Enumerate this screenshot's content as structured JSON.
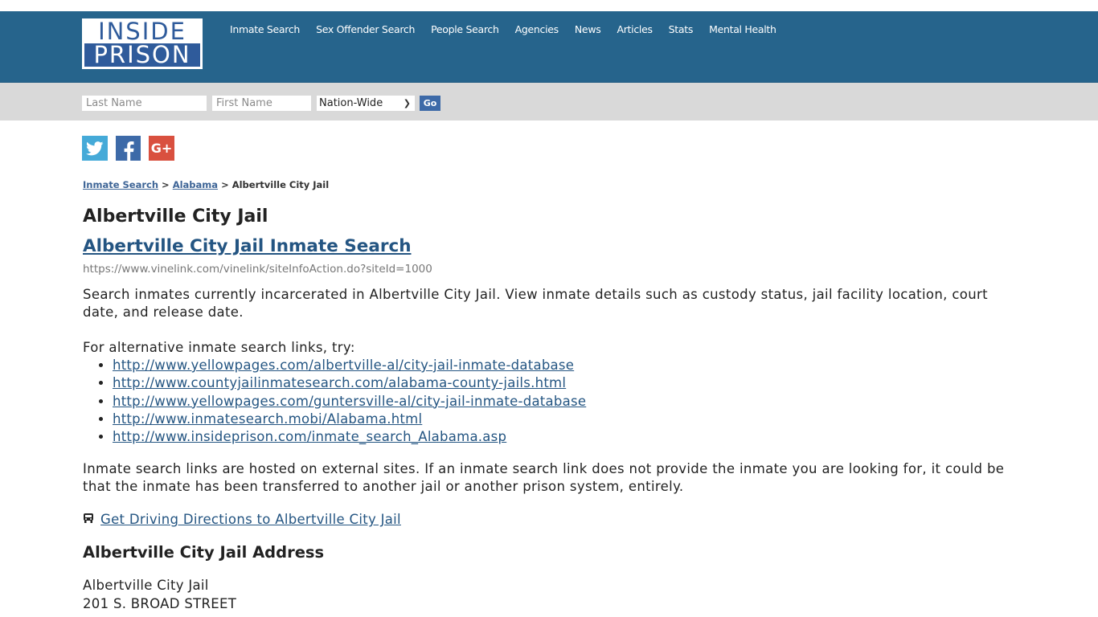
{
  "logo": {
    "line1": "INSIDE",
    "line2": "PRISON"
  },
  "nav": [
    {
      "label": "Inmate Search"
    },
    {
      "label": "Sex Offender Search"
    },
    {
      "label": "People Search"
    },
    {
      "label": "Agencies"
    },
    {
      "label": "News"
    },
    {
      "label": "Articles"
    },
    {
      "label": "Stats"
    },
    {
      "label": "Mental Health"
    }
  ],
  "search": {
    "last_name_placeholder": "Last Name",
    "first_name_placeholder": "First Name",
    "scope_selected": "Nation-Wide",
    "go_label": "Go"
  },
  "social": {
    "twitter": "twitter-icon",
    "facebook": "facebook-icon",
    "google_plus": "google-plus-icon",
    "gplus_text": "G+"
  },
  "breadcrumb": {
    "items": [
      "Inmate Search",
      "Alabama"
    ],
    "separator": ">",
    "current": "Albertville City Jail"
  },
  "page": {
    "title": "Albertville City Jail",
    "primary_link": "Albertville City Jail Inmate Search",
    "primary_url": "https://www.vinelink.com/vinelink/siteInfoAction.do?siteId=1000",
    "description": "Search inmates currently incarcerated in Albertville City Jail. View inmate details such as custody status, jail facility location, court date, and release date.",
    "alt_intro": "For alternative inmate search links, try:",
    "alt_links": [
      "http://www.yellowpages.com/albertville-al/city-jail-inmate-database",
      "http://www.countyjailinmatesearch.com/alabama-county-jails.html",
      "http://www.yellowpages.com/guntersville-al/city-jail-inmate-database",
      "http://www.inmatesearch.mobi/Alabama.html",
      "http://www.insideprison.com/inmate_search_Alabama.asp"
    ],
    "note": "Inmate search links are hosted on external sites. If an inmate search link does not provide the inmate you are looking for, it could be that the inmate has been transferred to another jail or another prison system, entirely.",
    "directions_icon": "bus-icon",
    "directions_link": "Get Driving Directions to Albertville City Jail",
    "address_heading": "Albertville City Jail Address",
    "address_lines": [
      "Albertville City Jail",
      "201 S. BROAD STREET"
    ]
  },
  "colors": {
    "header_bg": "#26648c",
    "searchbar_bg": "#d9d9d9",
    "link": "#245582",
    "go_button": "#3d6aa8",
    "twitter": "#45aad8",
    "facebook": "#3d6aa8",
    "google_plus": "#d9503f"
  }
}
